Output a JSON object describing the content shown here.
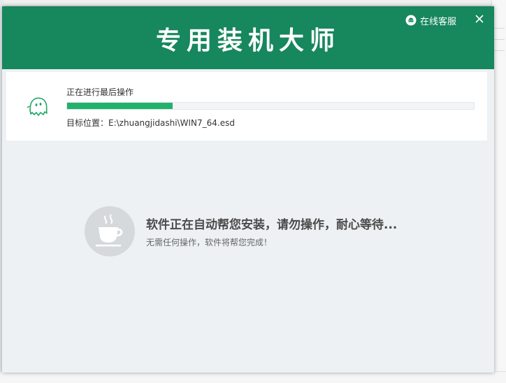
{
  "window": {
    "title": "专用装机大师",
    "service_label": "在线客服",
    "service_icon": "chat-bubble-icon",
    "close_icon": "close-icon"
  },
  "progress": {
    "status": "正在进行最后操作",
    "percent": 26,
    "target_label": "目标位置：",
    "target_path": "E:\\zhuangjidashi\\WIN7_64.esd",
    "icon": "ghost-icon"
  },
  "waiting": {
    "icon": "coffee-cup-icon",
    "main_text": "软件正在自动帮您安装，请勿操作，耐心等待...",
    "sub_text": "无需任何操作，软件将帮您完成！"
  },
  "colors": {
    "header_green": "#17875d",
    "progress_green": "#20b26b",
    "body_bg": "#edf1f4"
  }
}
